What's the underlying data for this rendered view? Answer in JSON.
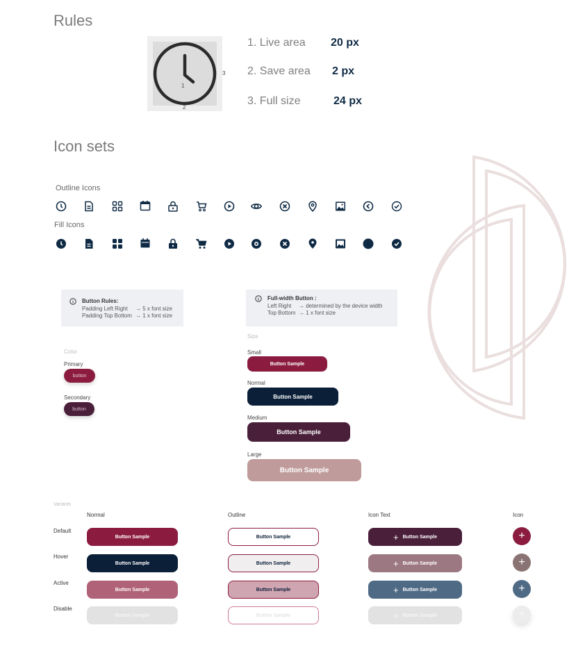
{
  "rules": {
    "title": "Rules",
    "items": [
      {
        "label": "1. Live area",
        "value": "20 px"
      },
      {
        "label": "2. Save area",
        "value": "2 px"
      },
      {
        "label": "3. Full size",
        "value": "24 px"
      }
    ],
    "diagram_marks": [
      "1",
      "2",
      "3"
    ]
  },
  "icon_sets": {
    "title": "Icon sets",
    "outline_label": "Outline Icons",
    "fill_label": "Fill Icons",
    "icons": [
      "clock-icon",
      "document-icon",
      "grid-icon",
      "calendar-icon",
      "lock-icon",
      "cart-icon",
      "play-icon",
      "eye-icon",
      "close-circle-icon",
      "location-icon",
      "image-icon",
      "chevron-left-icon",
      "check-circle-icon"
    ]
  },
  "button_rules": {
    "title": "Button Rules:",
    "line1_label": "Padding Left Right",
    "line1_value": "→ 5 x font size",
    "line2_label": "Padding Top Bottom",
    "line2_value": "→ 1 x font size"
  },
  "full_width": {
    "title": "Full-width Button :",
    "line1_label": "Left Right",
    "line1_value": "→ determined by the device width",
    "line2_label": "Top Bottom",
    "line2_value": "→ 1 x font size"
  },
  "color_section": {
    "title": "Color",
    "primary_label": "Primary",
    "secondary_label": "Secondary",
    "button_text": "button"
  },
  "size_section": {
    "title": "Size",
    "small_label": "Small",
    "normal_label": "Normal",
    "medium_label": "Medium",
    "large_label": "Large",
    "button_text": "Button Sample"
  },
  "variants": {
    "title": "Variants",
    "columns": [
      "Normal",
      "Outline",
      "Icon Text",
      "Icon"
    ],
    "rows": [
      "Default",
      "Hover",
      "Active",
      "Disable"
    ],
    "button_text": "Button Sample",
    "plus": "+"
  },
  "colors": {
    "primary": "#8b1c40",
    "navy": "#0b1f38",
    "plum": "#4a1f3a",
    "rose": "#c09b9b",
    "icon": "#0f2a44"
  }
}
